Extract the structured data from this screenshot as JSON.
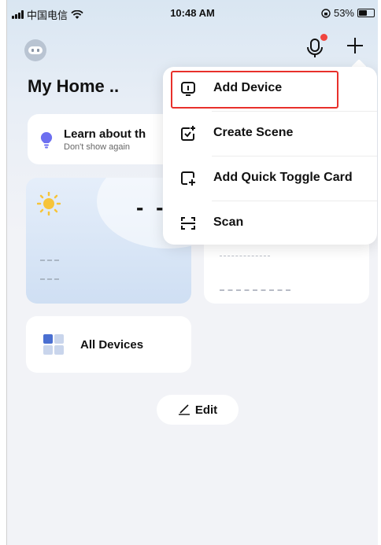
{
  "status_bar": {
    "carrier": "中国电信",
    "time": "10:48 AM",
    "battery_percent": "53%",
    "battery_level": 0.53
  },
  "header": {
    "home_title": "My Home ..",
    "mic_badge_color": "#f0453f"
  },
  "learn_card": {
    "title": "Learn about th",
    "subtitle": "Don't show again"
  },
  "weather_card": {
    "temperature": "- -",
    "icon": "sun-icon"
  },
  "all_devices": {
    "label": "All Devices",
    "icon": "grid-icon"
  },
  "edit": {
    "label": "Edit",
    "icon": "pencil-icon"
  },
  "menu": {
    "items": [
      {
        "label": "Add Device",
        "icon": "add-device-icon"
      },
      {
        "label": "Create Scene",
        "icon": "create-scene-icon"
      },
      {
        "label": "Add Quick Toggle Card",
        "icon": "quick-toggle-card-icon"
      },
      {
        "label": "Scan",
        "icon": "scan-icon"
      }
    ]
  },
  "colors": {
    "highlight": "#e8302b",
    "accent_blue": "#4a6fd1",
    "sun": "#f6c43a",
    "bulb": "#6d6ff0"
  }
}
